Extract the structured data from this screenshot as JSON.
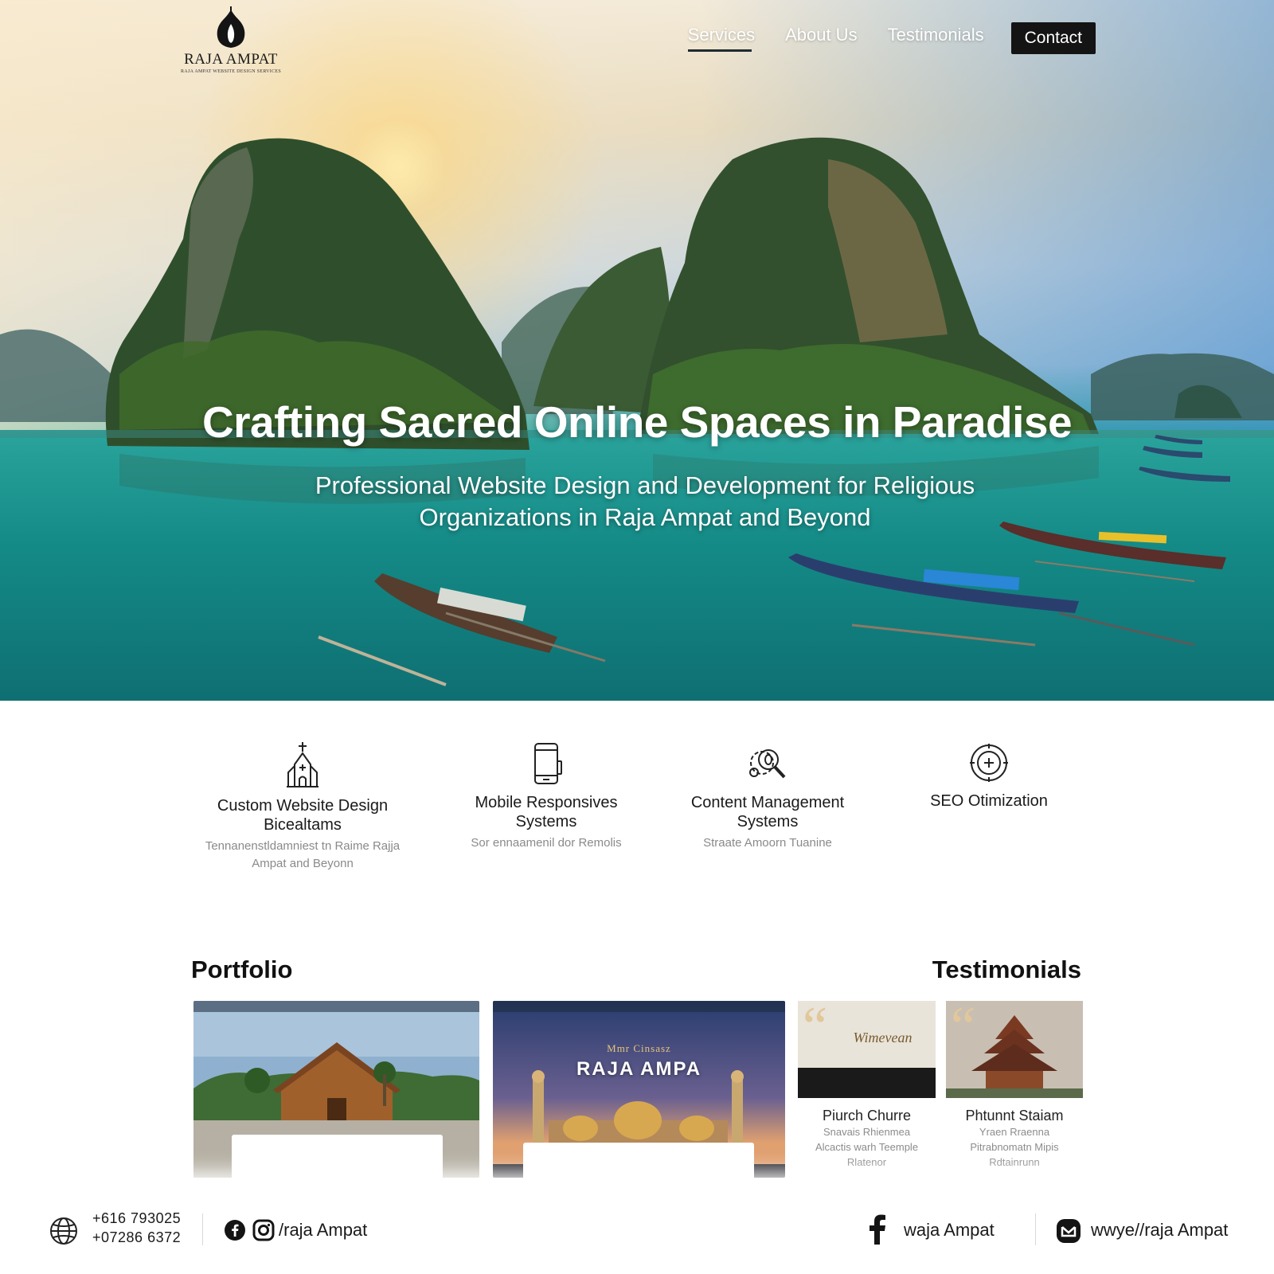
{
  "brand": {
    "name": "RAJA AMPAT",
    "tagline": "RAJA AMPAT WEBSITE DESIGN SERVICES"
  },
  "nav": {
    "items": [
      {
        "label": "Services",
        "active": true
      },
      {
        "label": "About Us",
        "active": false
      },
      {
        "label": "Testimonials",
        "active": false
      }
    ],
    "contact_label": "Contact"
  },
  "hero": {
    "title": "Crafting Sacred Online Spaces in Paradise",
    "subtitle": "Professional Website Design and Development for Religious Organizations in Raja Ampat and Beyond"
  },
  "services": [
    {
      "icon": "church-icon",
      "title": "Custom Website Design Bicealtams",
      "desc": "Tennanenstldamniest tn Raime Rajja Ampat and Beyonn"
    },
    {
      "icon": "mobile-phone-icon",
      "title": "Mobile Responsives Systems",
      "desc": "Sor ennaamenil dor Remolis"
    },
    {
      "icon": "gear-search-icon",
      "title": "Content Management Systems",
      "desc": "Straate Amoorn Tuanine"
    },
    {
      "icon": "target-icon",
      "title": "SEO Otimization",
      "desc": ""
    }
  ],
  "portfolio": {
    "heading": "Portfolio",
    "items": [
      {
        "name": "church-site",
        "caption": ""
      },
      {
        "name": "mosque-site",
        "kicker": "Mmr Cinsasz",
        "title": "RAJA AMPA"
      }
    ]
  },
  "testimonials": {
    "heading": "Testimonials",
    "items": [
      {
        "image_text": "Wimevean",
        "name": "Piurch Churre",
        "lines": [
          "Snavais Rhienmea",
          "Alcactis warh Teemple",
          "Rlatenor"
        ]
      },
      {
        "name": "Phtunnt Staiam",
        "lines": [
          "Yraen Rraenna",
          "Pitrabnomatn Mipis",
          "Rdtainrunn"
        ]
      }
    ]
  },
  "footer": {
    "phones": [
      "+616 793025",
      "+07286 6372"
    ],
    "social_handle_left": "/raja Ampat",
    "facebook_handle": "waja Ampat",
    "website": "wwye//raja Ampat"
  },
  "colors": {
    "nav_contact_bg": "#141414",
    "hero_water": "#148a86",
    "text_primary": "#1a1a1a",
    "text_muted": "#8a8a8a"
  }
}
